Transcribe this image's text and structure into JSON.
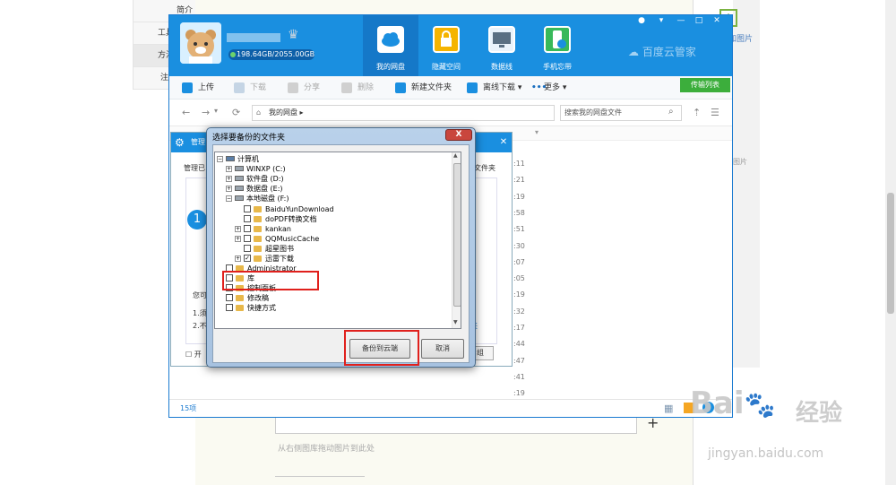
{
  "background": {
    "nav_items": [
      "简介",
      "工具/原料",
      "方法/步骤",
      "注意事项"
    ],
    "add_image": "加图片",
    "ghost_text": "图片",
    "drag_hint": "从右侧图库拖动图片到此处"
  },
  "app": {
    "quota": "198.64GB/2055.00GB",
    "tabs": [
      {
        "label": "我的网盘"
      },
      {
        "label": "隐藏空间"
      },
      {
        "label": "数据线"
      },
      {
        "label": "手机忘带"
      }
    ],
    "brand": "百度云管家",
    "toolbar": {
      "upload": "上传",
      "download": "下载",
      "share": "分享",
      "delete": "删除",
      "new_folder": "新建文件夹",
      "offline": "离线下载",
      "more": "更多",
      "transfer_list": "传输列表"
    },
    "path": "我的网盘",
    "search_placeholder": "搜索我的网盘文件",
    "times": [
      ":11",
      ":21",
      ":19",
      ":58",
      ":51",
      ":30",
      ":07",
      ":05",
      ":19",
      ":32",
      ":17",
      ":44",
      ":47",
      ":41",
      ":19"
    ],
    "item_count": "15项"
  },
  "manager_dialog": {
    "title": "管理",
    "label": "管理已",
    "right_label": "文件夹",
    "step": "1",
    "text1": "您可",
    "text2": "1.须",
    "text3": "2.不",
    "link": "夹",
    "checkbox_label": "开",
    "button": "组"
  },
  "folder_dialog": {
    "title": "选择要备份的文件夹",
    "tree": [
      {
        "label": "计算机",
        "indent": 0
      },
      {
        "label": "WINXP (C:)",
        "indent": 1
      },
      {
        "label": "软件盘 (D:)",
        "indent": 1
      },
      {
        "label": "数据盘 (E:)",
        "indent": 1
      },
      {
        "label": "本地磁盘 (F:)",
        "indent": 1
      },
      {
        "label": "BaiduYunDownload",
        "indent": 2
      },
      {
        "label": "doPDF转换文档",
        "indent": 2
      },
      {
        "label": "kankan",
        "indent": 2
      },
      {
        "label": "QQMusicCache",
        "indent": 2
      },
      {
        "label": "超星图书",
        "indent": 2
      },
      {
        "label": "迅雷下载",
        "indent": 2,
        "checked": true
      },
      {
        "label": "Administrator",
        "indent": 0
      },
      {
        "label": "库",
        "indent": 0
      },
      {
        "label": "控制面板",
        "indent": 0
      },
      {
        "label": "修改稿",
        "indent": 0
      },
      {
        "label": "快捷方式",
        "indent": 0
      }
    ],
    "ok": "备份到云端",
    "cancel": "取消"
  },
  "watermark": {
    "brand": "Bai",
    "cn": "经验",
    "url": "jingyan.baidu.com"
  },
  "colors": {
    "header": "#1a8fe0",
    "highlight": "#e0201c",
    "transfer": "#3cae3c"
  }
}
